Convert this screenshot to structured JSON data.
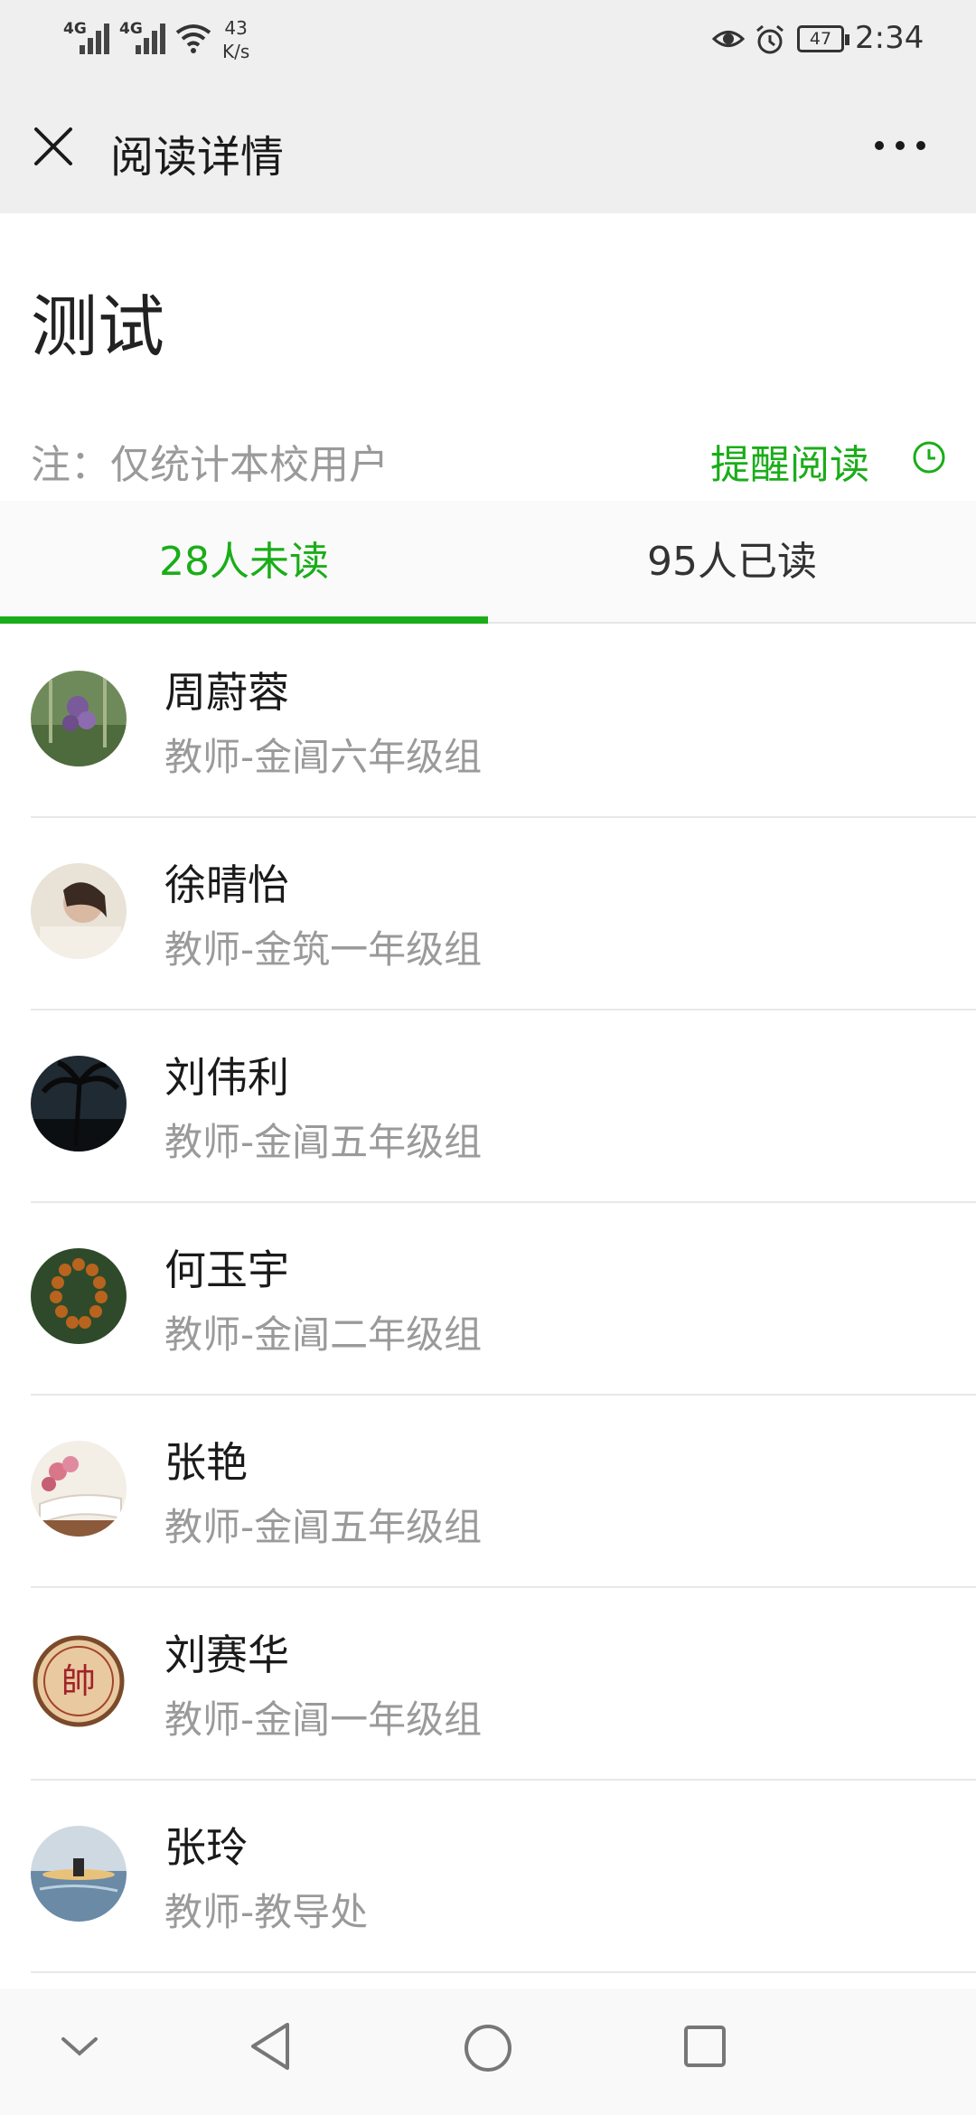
{
  "status_bar": {
    "sim1": "4G",
    "sim2": "4G",
    "net_speed_value": "43",
    "net_speed_unit": "K/s",
    "battery": "47",
    "time": "2:34",
    "icons": [
      "eye-icon",
      "alarm-icon",
      "battery-icon",
      "wifi-icon"
    ]
  },
  "header": {
    "title": "阅读详情",
    "close_icon": "close-icon",
    "more_icon": "more-icon"
  },
  "document": {
    "title": "测试",
    "note": "注：仅统计本校用户",
    "remind_label": "提醒阅读",
    "remind_icon": "clock-icon"
  },
  "tabs": [
    {
      "label": "28人未读",
      "active": true
    },
    {
      "label": "95人已读",
      "active": false
    }
  ],
  "list": [
    {
      "name": "周蔚蓉",
      "role": "教师-金阊六年级组"
    },
    {
      "name": "徐晴怡",
      "role": "教师-金筑一年级组"
    },
    {
      "name": "刘伟利",
      "role": "教师-金阊五年级组"
    },
    {
      "name": "何玉宇",
      "role": "教师-金阊二年级组"
    },
    {
      "name": "张艳",
      "role": "教师-金阊五年级组"
    },
    {
      "name": "刘赛华",
      "role": "教师-金阊一年级组",
      "avatar_text": "帥"
    },
    {
      "name": "张玲",
      "role": "教师-教导处"
    }
  ],
  "navbar": {
    "icons": [
      "collapse-icon",
      "back-icon",
      "home-icon",
      "recents-icon"
    ]
  },
  "colors": {
    "accent": "#1aad19",
    "header_bg": "#efefef",
    "secondary_text": "#9a9a9a"
  }
}
